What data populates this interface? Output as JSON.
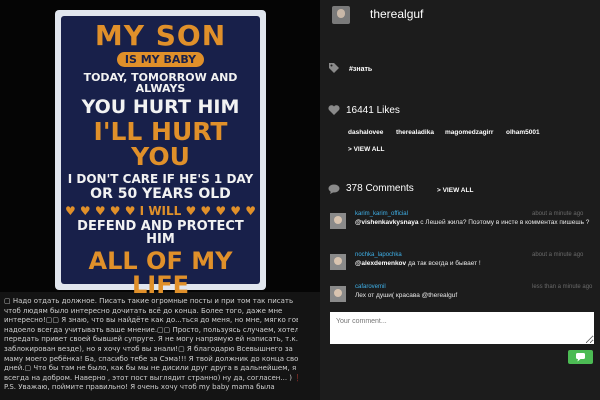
{
  "poster": {
    "line1": "MY SON",
    "line2": "IS MY BABY",
    "line3": "TODAY, TOMORROW AND ALWAYS",
    "line4": "YOU HURT HIM",
    "line5": "I'LL HURT YOU",
    "line6": "I DON'T CARE IF HE'S 1 DAY",
    "line7": "OR 50 YEARS OLD",
    "line8": "♥ ♥ ♥ ♥ ♥ I WILL ♥ ♥ ♥ ♥ ♥",
    "line9": "DEFEND AND PROTECT HIM",
    "line10": "ALL OF MY LIFE"
  },
  "caption": [
    "▢ Надо отдать должное. Писать такие огромные посты и при том так писать",
    "чтоб людям было интересно дочитать всё до конца. Более того, даже мне",
    "интересно!▢▢ Я знаю, что вы найдёте как до...ться до меня, но мне, мягко говоря,",
    "надоело всегда учитывать ваше мнение.▢▢ Просто, пользуясь случаем, хотел",
    "передать привет своей бывшей супруге. Я не могу напрямую ей написать, т.к.",
    "заблокирован везде), но я хочу чтоб вы знали!▢ Я благодарю Всевышнего за",
    "маму моего ребёнка! Ба, спасибо тебе за Сэма!!! Я твой должник до конца своих",
    "дней.▢ Что бы там не было, как бы мы не дисили друг друга в дальнейшем, я",
    "всегда на добром. Наверно , этот пост выглядит странно) ну да, согласен... ) ❗",
    "P.S. Уважаю, поймите правильно! Я очень хочу чтоб my baby mama была"
  ],
  "header": {
    "username": "therealguf"
  },
  "tag": {
    "label": "#знать"
  },
  "likes": {
    "count_text": "16441 Likes",
    "likers": [
      "dashalovee",
      "therealadika",
      "magomedzagirr",
      "olham5001"
    ],
    "view_all": "> VIEW ALL"
  },
  "comments": {
    "count_text": "378 Comments",
    "view_all": "> VIEW ALL",
    "items": [
      {
        "user": "karim_karim_official",
        "time": "about a minute ago",
        "mention": "@vishenkavkysnaya",
        "text": " с Лешей жила? Поэтому в инсте в комментах пишешь ?"
      },
      {
        "user": "nochka_lapochka",
        "time": "about a minute ago",
        "mention": "@alexdemenkov",
        "text": " да так всегда и бывает !"
      },
      {
        "user": "cafarovemil",
        "time": "less than a minute ago",
        "mention": "",
        "text": "Лех от души( красава @therealguf"
      }
    ]
  },
  "comment_input": {
    "placeholder": "Your comment..."
  },
  "colors": {
    "accent_orange": "#e0902a",
    "poster_navy": "#18204a",
    "link_blue": "#3fb0e8",
    "send_green": "#4cbb54"
  }
}
